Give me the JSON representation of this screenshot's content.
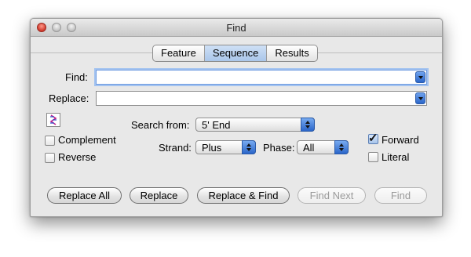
{
  "window": {
    "title": "Find"
  },
  "tabs": [
    "Feature",
    "Sequence",
    "Results"
  ],
  "active_tab": "Sequence",
  "find": {
    "label": "Find:",
    "value": ""
  },
  "replace": {
    "label": "Replace:",
    "value": ""
  },
  "search_from": {
    "label": "Search from:",
    "value": "5' End"
  },
  "strand": {
    "label": "Strand:",
    "value": "Plus"
  },
  "phase": {
    "label": "Phase:",
    "value": "All"
  },
  "options": {
    "complement": {
      "label": "Complement",
      "checked": false
    },
    "reverse": {
      "label": "Reverse",
      "checked": false
    },
    "forward": {
      "label": "Forward",
      "checked": true
    },
    "literal": {
      "label": "Literal",
      "checked": false
    }
  },
  "buttons": {
    "replace_all": "Replace All",
    "replace": "Replace",
    "replace_find": "Replace & Find",
    "find_next": "Find Next",
    "find": "Find"
  },
  "colors": {
    "accent": "#2b66c9",
    "focus_ring": "#a3c3f0",
    "close_button": "#d0382b"
  },
  "icons": [
    "close-icon",
    "minimize-icon",
    "zoom-icon",
    "sequence-strand-icon",
    "dropdown-arrow-icon",
    "popup-arrows-icon",
    "checkmark-icon"
  ]
}
